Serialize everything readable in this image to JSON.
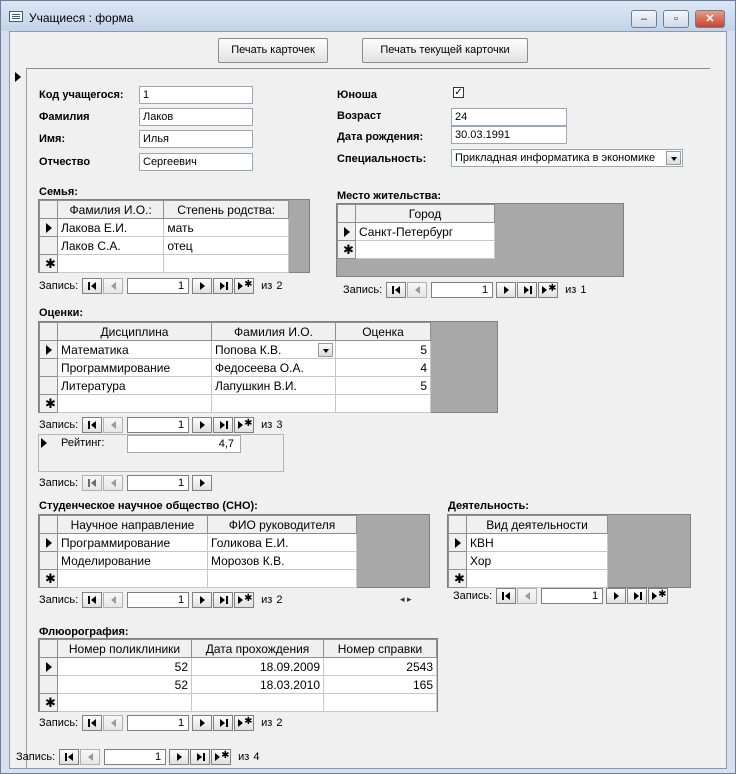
{
  "window": {
    "title": "Учащиеся : форма",
    "min": "‒",
    "max": "▫",
    "close": "✕"
  },
  "header": {
    "print_cards": "Печать карточек",
    "print_current": "Печать текущей карточки"
  },
  "fields": {
    "student_code": {
      "label": "Код учащегося:",
      "value": "1"
    },
    "last_name": {
      "label": "Фамилия",
      "value": "Лаков"
    },
    "first_name": {
      "label": "Имя:",
      "value": "Илья"
    },
    "patronymic": {
      "label": "Отчество",
      "value": "Сергеевич"
    },
    "male": {
      "label": "Юноша",
      "value": "✓"
    },
    "age": {
      "label": "Возраст",
      "value": "24"
    },
    "birth_date": {
      "label": "Дата рождения:",
      "value": "30.03.1991"
    },
    "specialty": {
      "label": "Специальность:",
      "value": "Прикладная информатика в экономике"
    }
  },
  "nav_caption": "Запись:",
  "nav_of": "из",
  "family": {
    "title": "Семья:",
    "columns": [
      "Фамилия И.О.:",
      "Степень родства:"
    ],
    "rows": [
      [
        "Лакова Е.И.",
        "мать"
      ],
      [
        "Лаков С.А.",
        "отец"
      ]
    ],
    "record": "1",
    "total": "2"
  },
  "residence": {
    "title": "Место жительства:",
    "columns": [
      "Город"
    ],
    "rows": [
      [
        "Санкт-Петербург"
      ]
    ],
    "record": "1",
    "total": "1"
  },
  "grades": {
    "title": "Оценки:",
    "columns": [
      "Дисциплина",
      "Фамилия И.О.",
      "Оценка"
    ],
    "rows": [
      [
        "Математика",
        "Попова К.В.",
        "5"
      ],
      [
        "Программирование",
        "Федосеева О.А.",
        "4"
      ],
      [
        "Литература",
        "Лапушкин В.И.",
        "5"
      ]
    ],
    "record": "1",
    "total": "3"
  },
  "rating": {
    "label": "Рейтинг:",
    "value": "4,7",
    "record": "1"
  },
  "sno": {
    "title": "Студенческое научное общество (СНО):",
    "columns": [
      "Научное направление",
      "ФИО руководителя"
    ],
    "rows": [
      [
        "Программирование",
        "Голикова Е.И."
      ],
      [
        "Моделирование",
        "Морозов К.В."
      ]
    ],
    "record": "1",
    "total": "2"
  },
  "activity": {
    "title": "Деятельность:",
    "columns": [
      "Вид деятельности"
    ],
    "rows": [
      [
        "КВН"
      ],
      [
        "Хор"
      ]
    ],
    "record": "1"
  },
  "fluoro": {
    "title": "Флюорография:",
    "columns": [
      "Номер поликлиники",
      "Дата прохождения",
      "Номер справки"
    ],
    "rows": [
      [
        "52",
        "18.09.2009",
        "2543"
      ],
      [
        "52",
        "18.03.2010",
        "165"
      ]
    ],
    "record": "1",
    "total": "2"
  },
  "main_nav": {
    "record": "1",
    "total": "4"
  },
  "new_row_marker": "✱"
}
